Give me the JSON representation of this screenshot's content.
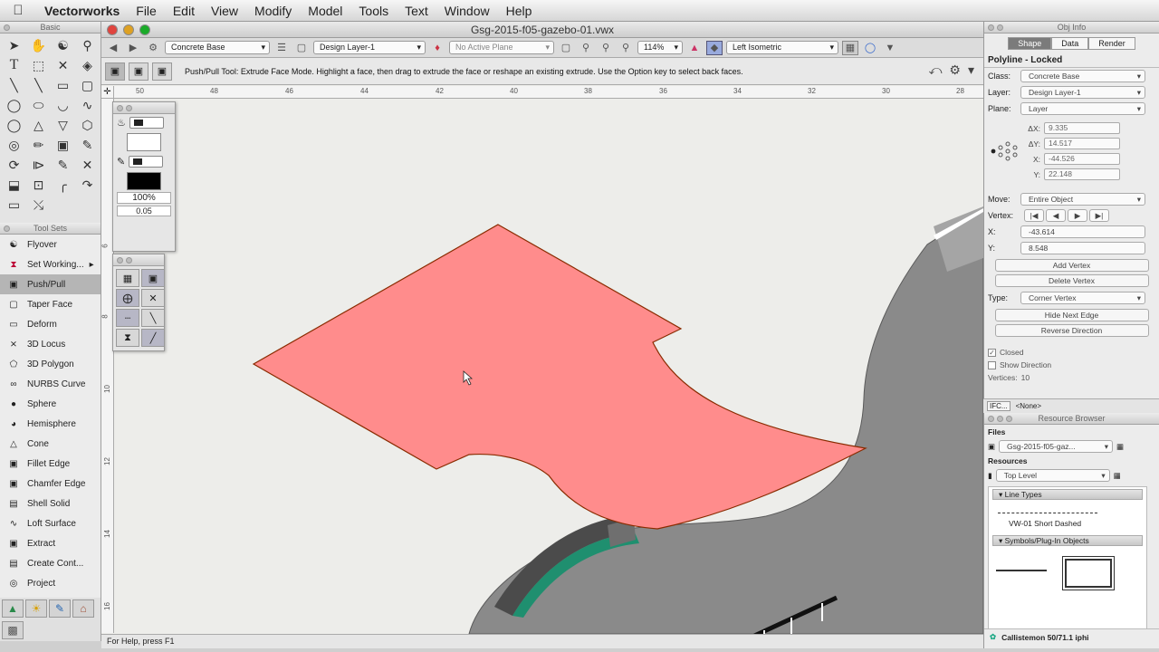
{
  "menubar": {
    "app": "Vectorworks",
    "items": [
      "File",
      "Edit",
      "View",
      "Modify",
      "Model",
      "Tools",
      "Text",
      "Window",
      "Help"
    ]
  },
  "basic_palette": {
    "title": "Basic"
  },
  "toolsets": {
    "title": "Tool Sets",
    "items": [
      {
        "label": "Flyover",
        "icon": "flyover-icon"
      },
      {
        "label": "Set Working...",
        "icon": "working-plane-icon"
      },
      {
        "label": "Push/Pull",
        "icon": "push-pull-icon"
      },
      {
        "label": "Taper Face",
        "icon": "taper-face-icon"
      },
      {
        "label": "Deform",
        "icon": "deform-icon"
      },
      {
        "label": "3D Locus",
        "icon": "locus-icon"
      },
      {
        "label": "3D Polygon",
        "icon": "polygon-icon"
      },
      {
        "label": "NURBS Curve",
        "icon": "nurbs-icon"
      },
      {
        "label": "Sphere",
        "icon": "sphere-icon"
      },
      {
        "label": "Hemisphere",
        "icon": "hemisphere-icon"
      },
      {
        "label": "Cone",
        "icon": "cone-icon"
      },
      {
        "label": "Fillet Edge",
        "icon": "fillet-icon"
      },
      {
        "label": "Chamfer Edge",
        "icon": "chamfer-icon"
      },
      {
        "label": "Shell Solid",
        "icon": "shell-icon"
      },
      {
        "label": "Loft Surface",
        "icon": "loft-icon"
      },
      {
        "label": "Extract",
        "icon": "extract-icon"
      },
      {
        "label": "Create Cont...",
        "icon": "contour-icon"
      },
      {
        "label": "Project",
        "icon": "project-icon"
      }
    ]
  },
  "document": {
    "title": "Gsg-2015-f05-gazebo-01.vwx",
    "class": "Concrete Base",
    "layer": "Design Layer-1",
    "plane": "No Active Plane",
    "zoom": "114%",
    "view": "Left Isometric",
    "help_text": "Push/Pull Tool: Extrude Face Mode. Highlight a face, then drag to extrude the face or reshape an existing extrude. Use the Option key to select back faces.",
    "status": "For Help, press F1",
    "ruler_h": [
      "50",
      "48",
      "46",
      "44",
      "42",
      "40",
      "38",
      "36",
      "34",
      "32",
      "30",
      "28"
    ],
    "ruler_v": [
      "6",
      "8",
      "10",
      "12",
      "14",
      "16"
    ]
  },
  "attributes": {
    "opacity": "100%",
    "line_weight": "0.05"
  },
  "colors": {
    "selected_face": "#ff8c8c",
    "gazebo": "#878787",
    "accent_green": "#1f8f6f"
  },
  "obj_info": {
    "title": "Obj Info",
    "tabs": [
      "Shape",
      "Data",
      "Render"
    ],
    "object_type": "Polyline - Locked",
    "class_label": "Class:",
    "class": "Concrete Base",
    "layer_label": "Layer:",
    "layer": "Design Layer-1",
    "plane_label": "Plane:",
    "plane": "Layer",
    "dx_label": "ΔX:",
    "dx": "9.335",
    "dy_label": "ΔY:",
    "dy": "14.517",
    "x_label": "X:",
    "x": "-44.526",
    "y_label": "Y:",
    "y": "22.148",
    "move_label": "Move:",
    "move": "Entire Object",
    "vertex_label": "Vertex:",
    "vx_label": "X:",
    "vx": "-43.614",
    "vy_label": "Y:",
    "vy": "8.548",
    "add_vertex": "Add Vertex",
    "delete_vertex": "Delete Vertex",
    "type_label": "Type:",
    "type": "Corner Vertex",
    "hide_next_edge": "Hide Next Edge",
    "reverse_direction": "Reverse Direction",
    "closed": "Closed",
    "show_direction": "Show Direction",
    "vertices_label": "Vertices:",
    "vertices": "10",
    "ifc": "IFC...",
    "ifc_value": "<None>"
  },
  "resource_browser": {
    "title": "Resource Browser",
    "files_label": "Files",
    "file": "Gsg-2015-f05-gaz...",
    "resources_label": "Resources",
    "level": "Top Level",
    "section_line_types": "Line Types",
    "line_type_item": "VW-01 Short Dashed",
    "section_symbols": "Symbols/Plug-In Objects",
    "footer": "Callistemon 50/71.1 iphi"
  }
}
